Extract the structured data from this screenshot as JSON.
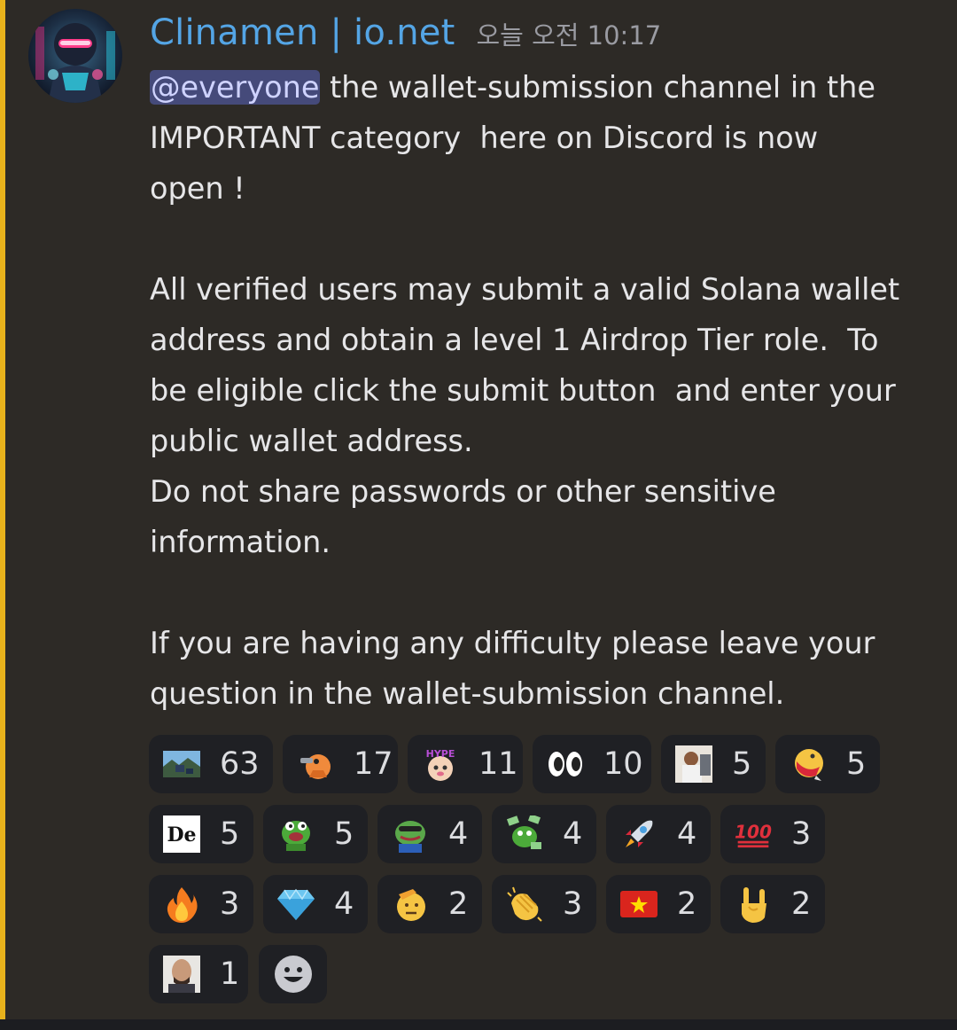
{
  "message": {
    "username": "Clinamen | io.net",
    "timestamp": "오늘 오전 10:17",
    "mention": "@everyone",
    "lines": [
      " the wallet-submission channel in the",
      "IMPORTANT category  here on Discord is now",
      "open !",
      "",
      "All verified users may submit a valid Solana wallet",
      "address and obtain a level 1 Airdrop Tier role.  To",
      "be eligible click the submit button  and enter your",
      "public wallet address.",
      "Do not share passwords or other sensitive",
      "information.",
      "",
      "If you are having any difficulty please leave your",
      "question in the wallet-submission channel."
    ]
  },
  "reactions": [
    {
      "emoji": "custom-landscape-emoji",
      "count": "63"
    },
    {
      "emoji": "custom-chainsaw-dog-emoji",
      "count": "17"
    },
    {
      "emoji": "custom-hype-emoji",
      "count": "11"
    },
    {
      "emoji": "eyes-emoji",
      "glyph": "👀",
      "count": "10"
    },
    {
      "emoji": "custom-photo-emoji",
      "count": "5"
    },
    {
      "emoji": "custom-yelling-emoji",
      "count": "5"
    },
    {
      "emoji": "custom-de-logo-emoji",
      "text": "De",
      "count": "5"
    },
    {
      "emoji": "custom-pepe-emoji",
      "count": "5"
    },
    {
      "emoji": "custom-pepe-cool-emoji",
      "count": "4"
    },
    {
      "emoji": "custom-pepe-money-emoji",
      "count": "4"
    },
    {
      "emoji": "rocket-emoji",
      "glyph": "🚀",
      "count": "4"
    },
    {
      "emoji": "hundred-points-emoji",
      "glyph": "💯",
      "count": "3"
    },
    {
      "emoji": "fire-emoji",
      "glyph": "🔥",
      "count": "3"
    },
    {
      "emoji": "gem-emoji",
      "glyph": "💎",
      "count": "4"
    },
    {
      "emoji": "saluting-face-emoji",
      "glyph": "🫡",
      "count": "2"
    },
    {
      "emoji": "clapping-hands-emoji",
      "glyph": "👏",
      "count": "3"
    },
    {
      "emoji": "vietnam-flag-emoji",
      "count": "2"
    },
    {
      "emoji": "sign-of-horns-emoji",
      "glyph": "🤘",
      "count": "2"
    },
    {
      "emoji": "custom-face-photo-emoji",
      "count": "1"
    }
  ],
  "colors": {
    "username": "#54a5e5",
    "highlight_bar": "#e8b21c",
    "mention_bg": "#454a7a",
    "reaction_bg": "#1f2024"
  }
}
